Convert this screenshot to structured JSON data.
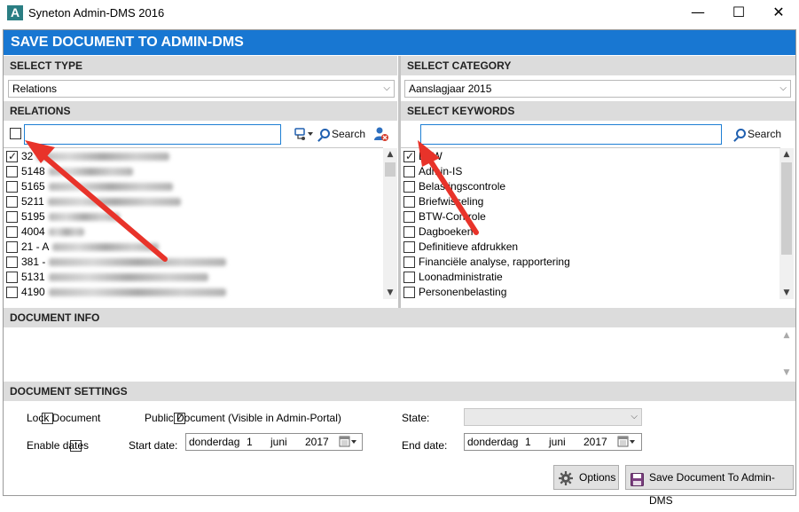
{
  "window": {
    "title": "Syneton Admin-DMS 2016",
    "icon_letter": "A",
    "minimize": "—",
    "maximize": "☐",
    "close": "✕"
  },
  "header": {
    "title": "SAVE DOCUMENT TO ADMIN-DMS"
  },
  "select_type": {
    "heading": "SELECT TYPE",
    "value": "Relations"
  },
  "select_category": {
    "heading": "SELECT CATEGORY",
    "value": "Aanslagjaar 2015"
  },
  "relations": {
    "heading": "RELATIONS",
    "search_label": "Search",
    "search_value": "",
    "items": [
      {
        "code": "32",
        "checked": true
      },
      {
        "code": "5148",
        "checked": false
      },
      {
        "code": "5165",
        "checked": false
      },
      {
        "code": "5211",
        "checked": false
      },
      {
        "code": "5195",
        "checked": false
      },
      {
        "code": "4004",
        "checked": false
      },
      {
        "code": "21 - A",
        "checked": false
      },
      {
        "code": "381 -",
        "checked": false
      },
      {
        "code": "5131",
        "checked": false
      },
      {
        "code": "4190",
        "checked": false
      }
    ]
  },
  "keywords": {
    "heading": "SELECT KEYWORDS",
    "search_label": "Search",
    "search_value": "",
    "items": [
      {
        "label": "BTW",
        "checked": true
      },
      {
        "label": "Admin-IS",
        "checked": false
      },
      {
        "label": "Belastingscontrole",
        "checked": false
      },
      {
        "label": "Briefwisseling",
        "checked": false
      },
      {
        "label": "BTW-Controle",
        "checked": false
      },
      {
        "label": "Dagboeken",
        "checked": false
      },
      {
        "label": "Definitieve afdrukken",
        "checked": false
      },
      {
        "label": "Financiële analyse, rapportering",
        "checked": false
      },
      {
        "label": "Loonadministratie",
        "checked": false
      },
      {
        "label": "Personenbelasting",
        "checked": false
      }
    ]
  },
  "document_info": {
    "heading": "DOCUMENT INFO",
    "value": ""
  },
  "settings": {
    "heading": "DOCUMENT SETTINGS",
    "lock_document": "Lock Document",
    "lock_checked": false,
    "public_document": "Public Document (Visible in Admin-Portal)",
    "public_checked": true,
    "state_label": "State:",
    "state_value": "",
    "enable_dates": "Enable dates",
    "enable_checked": false,
    "start_label": "Start date:",
    "start_date": {
      "weekday": "donderdag",
      "day": "1",
      "month": "juni",
      "year": "2017"
    },
    "end_label": "End date:",
    "end_date": {
      "weekday": "donderdag",
      "day": "1",
      "month": "juni",
      "year": "2017"
    }
  },
  "buttons": {
    "options": "Options",
    "save": "Save Document To Admin-DMS"
  },
  "colors": {
    "header_blue": "#1877d2",
    "section_gray": "#dcdcdc",
    "annotation_red": "#e8332a"
  }
}
